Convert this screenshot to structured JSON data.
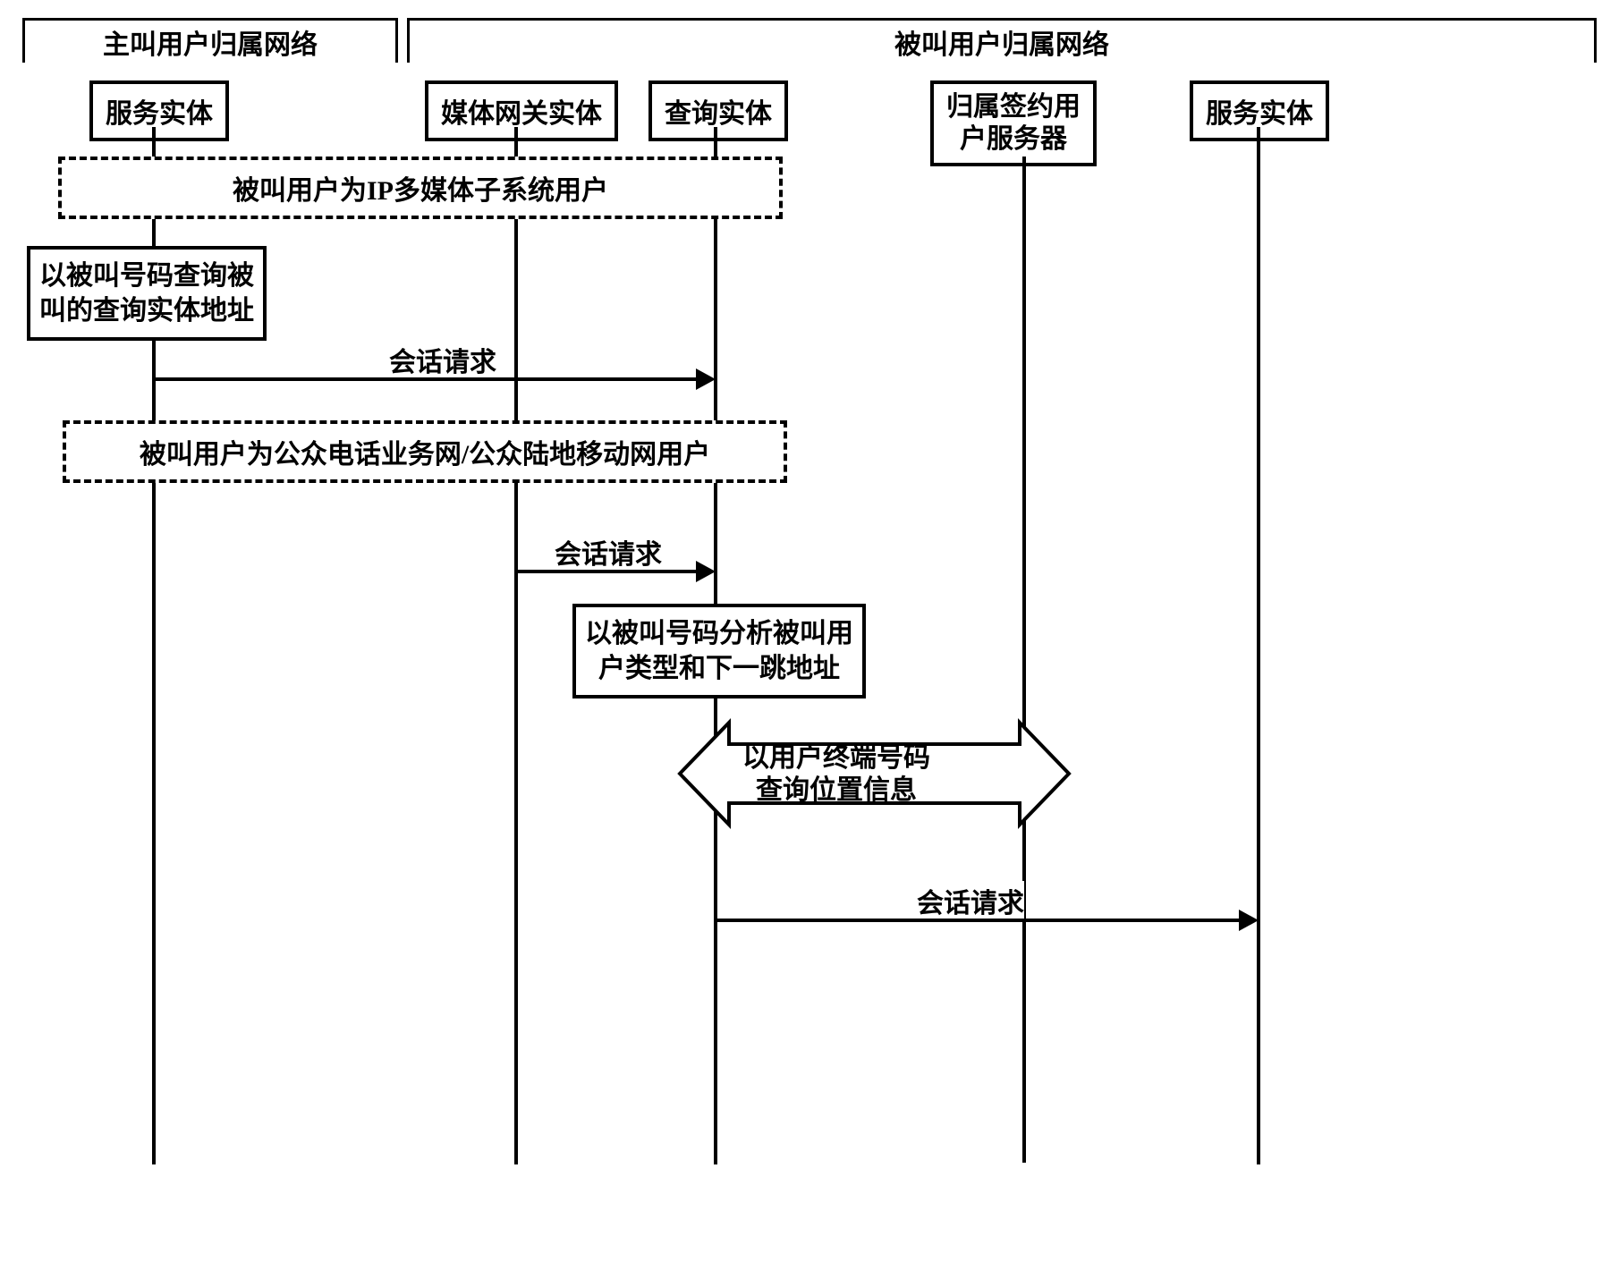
{
  "networks": {
    "caller": "主叫用户归属网络",
    "callee": "被叫用户归属网络"
  },
  "entities": {
    "service_entity_left": "服务实体",
    "media_gateway": "媒体网关实体",
    "query_entity": "查询实体",
    "hss": "归属签约用\n户服务器",
    "service_entity_right": "服务实体"
  },
  "conditions": {
    "ims_user": "被叫用户为IP多媒体子系统用户",
    "pstn_user": "被叫用户为公众电话业务网/公众陆地移动网用户"
  },
  "notes": {
    "query_address": "以被叫号码查询被\n叫的查询实体地址",
    "analyze_type": "以被叫号码分析被叫用\n户类型和下一跳地址",
    "query_location": "以用户终端号码\n查询位置信息"
  },
  "messages": {
    "session_req_1": "会话请求",
    "session_req_2": "会话请求",
    "session_req_3": "会话请求"
  }
}
